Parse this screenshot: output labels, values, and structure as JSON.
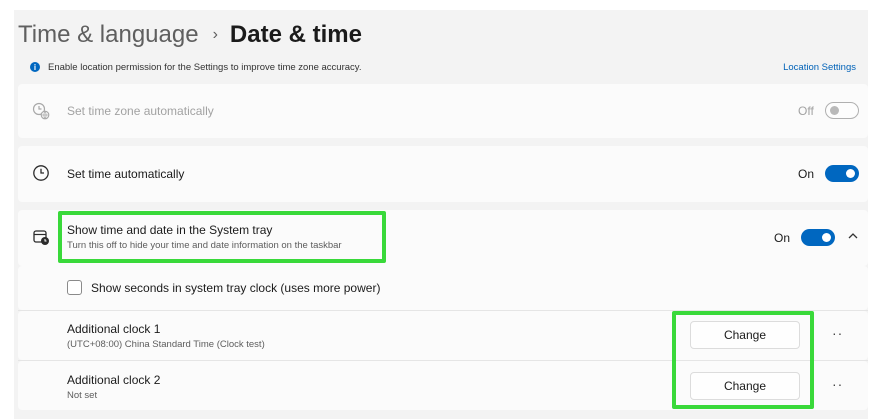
{
  "breadcrumb": {
    "parent": "Time & language",
    "separator": "›",
    "current": "Date & time"
  },
  "info_bar": {
    "icon": "info-icon",
    "message": "Enable location permission for the Settings to improve time zone accuracy.",
    "link": "Location Settings"
  },
  "rows": {
    "timezone_auto": {
      "icon": "globe-clock-icon",
      "label": "Set time zone automatically",
      "state": "Off",
      "enabled": false
    },
    "time_auto": {
      "icon": "clock-icon",
      "label": "Set time automatically",
      "state": "On"
    },
    "system_tray": {
      "icon": "calendar-clock-icon",
      "label": "Show time and date in the System tray",
      "description": "Turn this off to hide your time and date information on the taskbar",
      "state": "On",
      "expand_icon": "chevron-up-icon"
    },
    "show_seconds": {
      "label": "Show seconds in system tray clock (uses more power)",
      "checked": false
    },
    "clock1": {
      "label": "Additional clock 1",
      "detail": "(UTC+08:00) China Standard Time (Clock test)",
      "button": "Change",
      "more": "··"
    },
    "clock2": {
      "label": "Additional clock 2",
      "detail": "Not set",
      "button": "Change",
      "more": "··"
    }
  },
  "colors": {
    "accent": "#0067c0",
    "highlight": "#39d93a"
  }
}
